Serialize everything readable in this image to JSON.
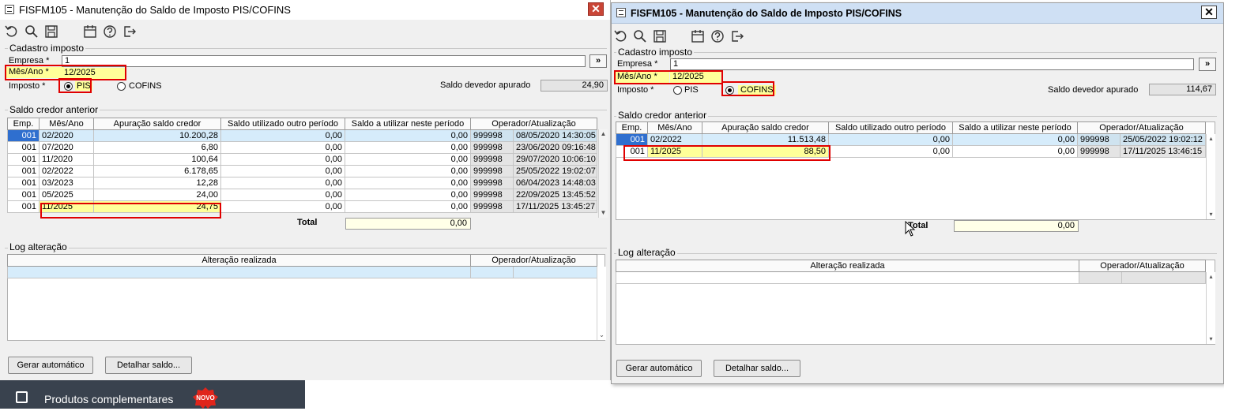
{
  "colors": {
    "highlight": "#e00000",
    "field_yellow": "#ffff99",
    "selected_row": "#d6ecfb",
    "current_cell": "#2f6fcf",
    "taskbar": "#39424e",
    "badge_red": "#e0251b"
  },
  "left": {
    "title": "FISFM105 - Manutenção do Saldo de Imposto PIS/COFINS",
    "close": "✕",
    "toolbar_icons": [
      "undo-icon",
      "search-icon",
      "save-icon",
      "calendar-icon",
      "help-icon",
      "exit-icon"
    ],
    "cadastro": {
      "group_label": "Cadastro imposto",
      "empresa_label": "Empresa *",
      "empresa_value": "1",
      "lookup_btn": "»",
      "mesano_label": "Mês/Ano *",
      "mesano_value": "12/2025",
      "imposto_label": "Imposto *",
      "opt_pis": "PIS",
      "opt_cofins": "COFINS",
      "saldo_label": "Saldo devedor apurado",
      "saldo_value": "24,90"
    },
    "saldo_credor": {
      "group_label": "Saldo credor anterior",
      "headers": [
        "Emp.",
        "Mês/Ano",
        "Apuração saldo credor",
        "Saldo utilizado outro período",
        "Saldo a utilizar neste período",
        "Operador/Atualização"
      ],
      "rows": [
        [
          "001",
          "02/2020",
          "10.200,28",
          "0,00",
          "0,00",
          "999998",
          "08/05/2020 14:30:05"
        ],
        [
          "001",
          "07/2020",
          "6,80",
          "0,00",
          "0,00",
          "999998",
          "23/06/2020 09:16:48"
        ],
        [
          "001",
          "11/2020",
          "100,64",
          "0,00",
          "0,00",
          "999998",
          "29/07/2020 10:06:10"
        ],
        [
          "001",
          "02/2022",
          "6.178,65",
          "0,00",
          "0,00",
          "999998",
          "25/05/2022 19:02:07"
        ],
        [
          "001",
          "03/2023",
          "12,28",
          "0,00",
          "0,00",
          "999998",
          "06/04/2023 14:48:03"
        ],
        [
          "001",
          "05/2025",
          "24,00",
          "0,00",
          "0,00",
          "999998",
          "22/09/2025 13:45:52"
        ],
        [
          "001",
          "11/2025",
          "24,75",
          "0,00",
          "0,00",
          "999998",
          "17/11/2025 13:45:27"
        ]
      ],
      "total_label": "Total",
      "total_value": "0,00"
    },
    "log": {
      "group_label": "Log alteração",
      "headers": [
        "Alteração realizada",
        "Operador/Atualização"
      ]
    },
    "buttons": {
      "gerar": "Gerar automático",
      "detalhar": "Detalhar saldo..."
    }
  },
  "right": {
    "title": "FISFM105 - Manutenção do Saldo de Imposto PIS/COFINS",
    "close": "✕",
    "toolbar_icons": [
      "undo-icon",
      "search-icon",
      "save-icon",
      "calendar-icon",
      "help-icon",
      "exit-icon"
    ],
    "cadastro": {
      "group_label": "Cadastro imposto",
      "empresa_label": "Empresa *",
      "empresa_value": "1",
      "lookup_btn": "»",
      "mesano_label": "Mês/Ano *",
      "mesano_value": "12/2025",
      "imposto_label": "Imposto *",
      "opt_pis": "PIS",
      "opt_cofins": "COFINS",
      "saldo_label": "Saldo devedor apurado",
      "saldo_value": "114,67"
    },
    "saldo_credor": {
      "group_label": "Saldo credor anterior",
      "headers": [
        "Emp.",
        "Mês/Ano",
        "Apuração saldo credor",
        "Saldo utilizado outro período",
        "Saldo a utilizar neste período",
        "Operador/Atualização"
      ],
      "rows": [
        [
          "001",
          "02/2022",
          "11.513,48",
          "0,00",
          "0,00",
          "999998",
          "25/05/2022 19:02:12"
        ],
        [
          "001",
          "11/2025",
          "88,50",
          "0,00",
          "0,00",
          "999998",
          "17/11/2025 13:46:15"
        ]
      ],
      "total_label": "Total",
      "total_value": "0,00"
    },
    "log": {
      "group_label": "Log alteração",
      "headers": [
        "Alteração realizada",
        "Operador/Atualização"
      ]
    },
    "buttons": {
      "gerar": "Gerar automático",
      "detalhar": "Detalhar saldo..."
    }
  },
  "taskbar": {
    "label": "Produtos complementares",
    "badge": "NOVO"
  }
}
